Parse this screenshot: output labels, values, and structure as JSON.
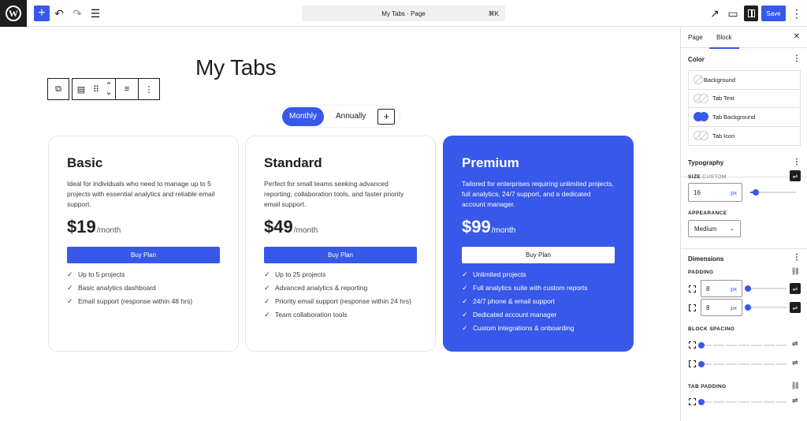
{
  "topbar": {
    "logo_letter": "W",
    "add_icon": "+",
    "undo_icon": "↶",
    "redo_icon": "↷",
    "list_view_icon": "☰",
    "doc_title": "My Tabs · Page",
    "doc_shortcut": "⌘K",
    "view_icon": "↗",
    "device_icon": "▭",
    "save_label": "Save",
    "more_icon": "⋮"
  },
  "canvas": {
    "page_title": "My Tabs",
    "block_toolbar": {
      "parent_icon": "⧉",
      "align_icon": "▤",
      "drag_icon": "⠿",
      "move_up_icon": "⌃",
      "move_down_icon": "⌄",
      "justify_icon": "≡",
      "options_icon": "⋮"
    },
    "tabs": [
      {
        "label": "Monthly",
        "active": true
      },
      {
        "label": "Annually",
        "active": false
      }
    ],
    "tab_add_icon": "+",
    "cards": [
      {
        "title": "Basic",
        "description": "Ideal for individuals who need to manage up to 5 projects with essential analytics and reliable email support.",
        "price": "$19",
        "period": "/month",
        "button": "Buy Plan",
        "features": [
          "Up to 5 projects",
          "Basic analytics dashboard",
          "Email support (response within 48 hrs)"
        ]
      },
      {
        "title": "Standard",
        "description": "Perfect for small teams seeking advanced reporting, collaboration tools, and faster priority email support.",
        "price": "$49",
        "period": "/month",
        "button": "Buy Plan",
        "features": [
          "Up to 25 projects",
          "Advanced analytics & reporting",
          "Priority email support (response within 24 hrs)",
          "Team collaboration tools"
        ]
      },
      {
        "title": "Premium",
        "description": "Tailored for enterprises requiring unlimited projects, full analytics, 24/7 support, and a dedicated account manager.",
        "price": "$99",
        "period": "/month",
        "button": "Buy Plan",
        "features": [
          "Unlimited projects",
          "Full analytics suite with custom reports",
          "24/7 phone & email support",
          "Dedicated account manager",
          "Custom integrations & onboarding"
        ]
      }
    ],
    "check_glyph": "✓"
  },
  "sidebar": {
    "tabs": {
      "page": "Page",
      "block": "Block"
    },
    "close_icon": "✕",
    "color": {
      "heading": "Color",
      "items": [
        "Background",
        "Tab Text",
        "Tab Background",
        "Tab Icon"
      ]
    },
    "typography": {
      "heading": "Typography",
      "size_label": "SIZE",
      "size_mode": "CUSTOM",
      "size_value": "16",
      "size_unit": "px",
      "size_slider_fraction": 0.12,
      "appearance_label": "APPEARANCE",
      "appearance_value": "Medium",
      "chevron": "⌄"
    },
    "dimensions": {
      "heading": "Dimensions",
      "padding_label": "PADDING",
      "padding_vertical": "8",
      "padding_horizontal": "8",
      "padding_unit": "px",
      "padding_slider_fraction": 0.05,
      "block_spacing_label": "BLOCK SPACING",
      "tab_padding_label": "TAB PADDING",
      "link_icon": "⛓",
      "sliders_icon": "⇌"
    },
    "accent_color": "#3858e9"
  }
}
